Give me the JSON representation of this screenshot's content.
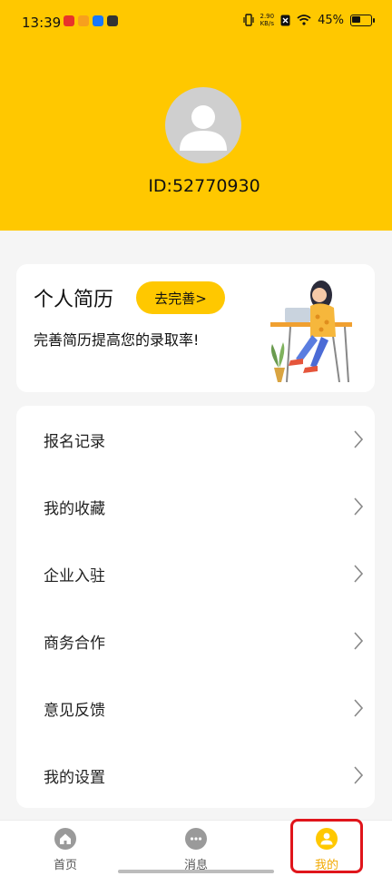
{
  "status_bar": {
    "time": "13:39",
    "net_speed_value": "2.90",
    "net_speed_unit": "KB/s",
    "battery": "45%"
  },
  "profile": {
    "id_text": "ID:52770930"
  },
  "resume_card": {
    "title": "个人简历",
    "button_label": "去完善>",
    "subtitle": "完善简历提高您的录取率!"
  },
  "menu": {
    "items": [
      {
        "label": "报名记录"
      },
      {
        "label": "我的收藏"
      },
      {
        "label": "企业入驻"
      },
      {
        "label": "商务合作"
      },
      {
        "label": "意见反馈"
      },
      {
        "label": "我的设置"
      }
    ]
  },
  "tabbar": {
    "tabs": [
      {
        "label": "首页",
        "icon": "home-icon"
      },
      {
        "label": "消息",
        "icon": "message-icon"
      },
      {
        "label": "我的",
        "icon": "profile-icon"
      }
    ],
    "active_tab": "我的"
  },
  "colors": {
    "brand_yellow": "#ffc800",
    "active_tab_text": "#f2a900",
    "highlight_red": "#e0151b"
  }
}
